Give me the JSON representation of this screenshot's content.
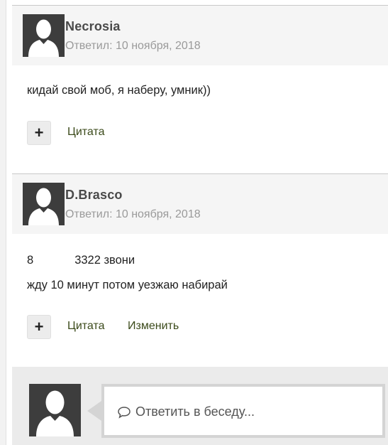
{
  "posts": [
    {
      "author": "Necrosia",
      "replied": "Ответил: 10 ноября, 2018",
      "lines": [
        "кидай свой моб, я наберу, умник))"
      ],
      "actions": {
        "plus": "+",
        "quote": "Цитата"
      }
    },
    {
      "author": "D.Brasco",
      "replied": "Ответил: 10 ноября, 2018",
      "phone_prefix": "8",
      "phone_suffix": "3322 звони",
      "line2": "жду 10 минут потом уезжаю набирай",
      "actions": {
        "plus": "+",
        "quote": "Цитата",
        "edit": "Изменить"
      }
    }
  ],
  "reply": {
    "placeholder": "Ответить в беседу..."
  },
  "colors": {
    "avatar_bg": "#3d3d3d",
    "header_bg": "#f5f5f5",
    "link": "#3b4a1a",
    "reply_bg": "#ebebeb"
  },
  "icons": {
    "avatar": "default-user-silhouette-icon",
    "comment": "speech-bubble-icon"
  }
}
